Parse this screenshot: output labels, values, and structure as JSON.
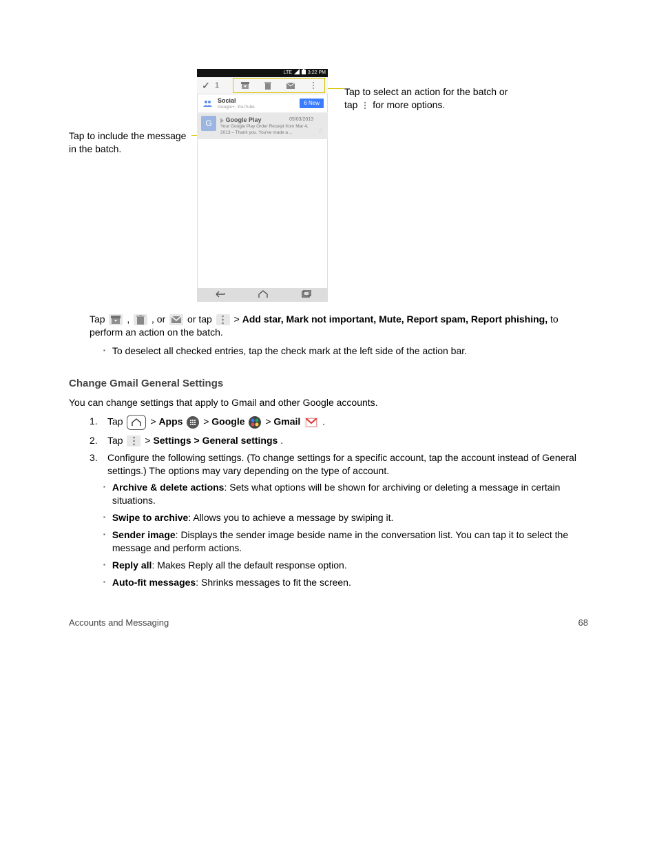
{
  "figure": {
    "callout_left": "Tap to include the message in the batch.",
    "callout_right_1": "Tap to select an action for the batch or tap ",
    "callout_right_2": " for more options.",
    "status": {
      "carrier": "LTE",
      "time": "3:22 PM"
    },
    "actionbar": {
      "checkmark": "✓",
      "count": "1"
    },
    "social": {
      "title": "Social",
      "subtitle": "Google+, YouTube",
      "badge": "6 New"
    },
    "message": {
      "avatar": "G",
      "sender": "Google Play",
      "date": "05/03/2013",
      "preview": "Your Google Play Order Receipt from Mar 4, 2013 – Thank you. You've made a…"
    }
  },
  "body": {
    "p1_a": "Tap ",
    "p1_archive": ", ",
    "p1_delete": ", or ",
    "p1_mark": " or tap ",
    "p1_more": " > ",
    "p1_b": "Add star, Mark not important, Mute, Report spam, Report phishing,",
    "p1_c": " to perform an action on the batch.",
    "bullet_deselect": "To deselect all checked entries, tap the check mark at the left side of the action bar.",
    "sec_general": "Change Gmail General Settings",
    "gen_desc": "You can change settings that apply to Gmail and other Google accounts.",
    "gen_step1_a": "Tap ",
    "gen_step1_b": " > ",
    "gen_step1_c": "Apps ",
    "gen_step1_d": " > ",
    "gen_step1_e": "Google ",
    "gen_step1_f": " > ",
    "gen_step1_g": "Gmail ",
    "gen_step1_h": ".",
    "gen_step2_a": "Tap ",
    "gen_step2_b": " > ",
    "gen_step2_c": "Settings > General settings",
    "gen_step2_d": ".",
    "gen_step3": "Configure the following settings. (To change settings for a specific account, tap the account instead of General settings.) The options may vary depending on the type of account.",
    "b_archive_t": "Archive & delete actions",
    "b_archive_b": ": Sets what options will be shown for archiving or deleting a message in certain situations.",
    "b_swipe_t": "Swipe to archive",
    "b_swipe_b": ": Allows you to achieve a message by swiping it.",
    "b_sender_t": "Sender image",
    "b_sender_b": ": Displays the sender image beside name in the conversation list. You can tap it to select the message and perform actions.",
    "b_reply_t": "Reply all",
    "b_reply_b": ": Makes Reply all the default response option.",
    "b_autofit_t": "Auto-fit messages",
    "b_autofit_b": ": Shrinks messages to fit the screen.",
    "footer_left": "Accounts and Messaging",
    "footer_right": "68"
  }
}
